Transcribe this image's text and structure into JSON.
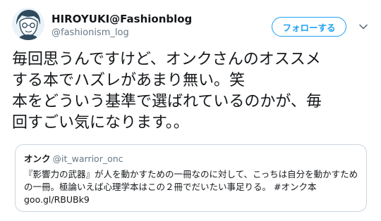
{
  "tweet": {
    "author": {
      "display_name": "HIROYUKI@Fashionblog",
      "handle": "@fashionism_log",
      "avatar_icon": "illustrated-face-avatar"
    },
    "follow_label": "フォローする",
    "more_icon": "chevron-down-icon",
    "text_lines": [
      "毎回思うんですけど、オンクさんのオススメ",
      "する本でハズレがあまり無い。笑",
      "本をどういう基準で選ばれているのかが、毎",
      "回すごい気になります。。"
    ]
  },
  "quoted_tweet": {
    "author_name": "オンク",
    "handle": "@it_warrior_onc",
    "text_lines": [
      "『影響力の武器』が人を動かすための一冊なのに対して、こっちは自分を動かすため",
      "の一冊。極論いえば心理学本はこの２冊でだいたい事足りる。 #オンク本",
      "goo.gl/RBUBk9"
    ]
  },
  "colors": {
    "accent": "#1da1f2",
    "text": "#14171a",
    "secondary_text": "#657786",
    "border": "#ccd6dd"
  }
}
